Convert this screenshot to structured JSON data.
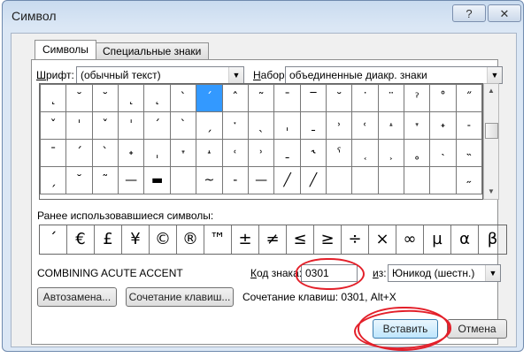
{
  "window": {
    "title": "Символ",
    "help_label": "?",
    "close_label": "✕"
  },
  "tabs": [
    {
      "label": "Символы",
      "active": true
    },
    {
      "label": "Специальные знаки",
      "active": false
    }
  ],
  "font": {
    "label_prefix": "Ш",
    "label_rest": "рифт:",
    "value": "(обычный текст)"
  },
  "subset": {
    "label_prefix": "Н",
    "label_rest": "абор:",
    "value": "объединенные диакр. знаки"
  },
  "grid_rows": [
    [
      "˛",
      "˘",
      "˘",
      "˛",
      "˛",
      "`",
      "ˊ",
      "ˆ",
      "˜",
      "¯",
      "‾",
      "˘",
      "˙",
      "¨",
      "ˀ",
      "˚",
      "˝"
    ],
    [
      "ˇ",
      "ˈ",
      "ˇ",
      "ˈ",
      "ˊ",
      "ˋ",
      "ˏ",
      "ˑ",
      "ˎ",
      "ˌ",
      "ˍ",
      "˒",
      "˓",
      "˔",
      "˕",
      "˖",
      "˗"
    ],
    [
      "ˉ",
      "ˊ",
      "ˋ",
      "˖",
      "ˌ",
      "˕",
      "˔",
      "˓",
      "˒",
      "ˍ",
      "˞",
      "ˁ",
      "˱",
      "˲",
      "˳",
      "˴",
      "˵"
    ],
    [
      "ˏ",
      "˘",
      "˜",
      "—",
      "▬",
      "",
      "~",
      "‐",
      "—",
      "╱",
      "╱",
      "",
      "",
      "",
      "",
      "",
      "˶"
    ]
  ],
  "selected": {
    "row": 0,
    "col": 6
  },
  "recent_label": "Ранее использовавшиеся символы:",
  "recent_symbols": [
    "ˊ",
    "€",
    "£",
    "¥",
    "©",
    "®",
    "™",
    "±",
    "≠",
    "≤",
    "≥",
    "÷",
    "×",
    "∞",
    "µ",
    "α",
    "β"
  ],
  "char_name": "COMBINING ACUTE ACCENT",
  "code": {
    "label_prefix": "К",
    "label_rest": "од знака:",
    "value": "0301"
  },
  "from": {
    "label_prefix": "и",
    "label_rest": "з:",
    "value": "Юникод (шестн.)"
  },
  "buttons": {
    "autocorrect": "Автозамена...",
    "shortcut_key": "Сочетание клавиш...",
    "insert": "Вставить",
    "cancel": "Отмена"
  },
  "shortcut_text": "Сочетание клавиш: 0301, Alt+X",
  "colors": {
    "annotation": "#e3202a",
    "selection": "#3399ff"
  }
}
